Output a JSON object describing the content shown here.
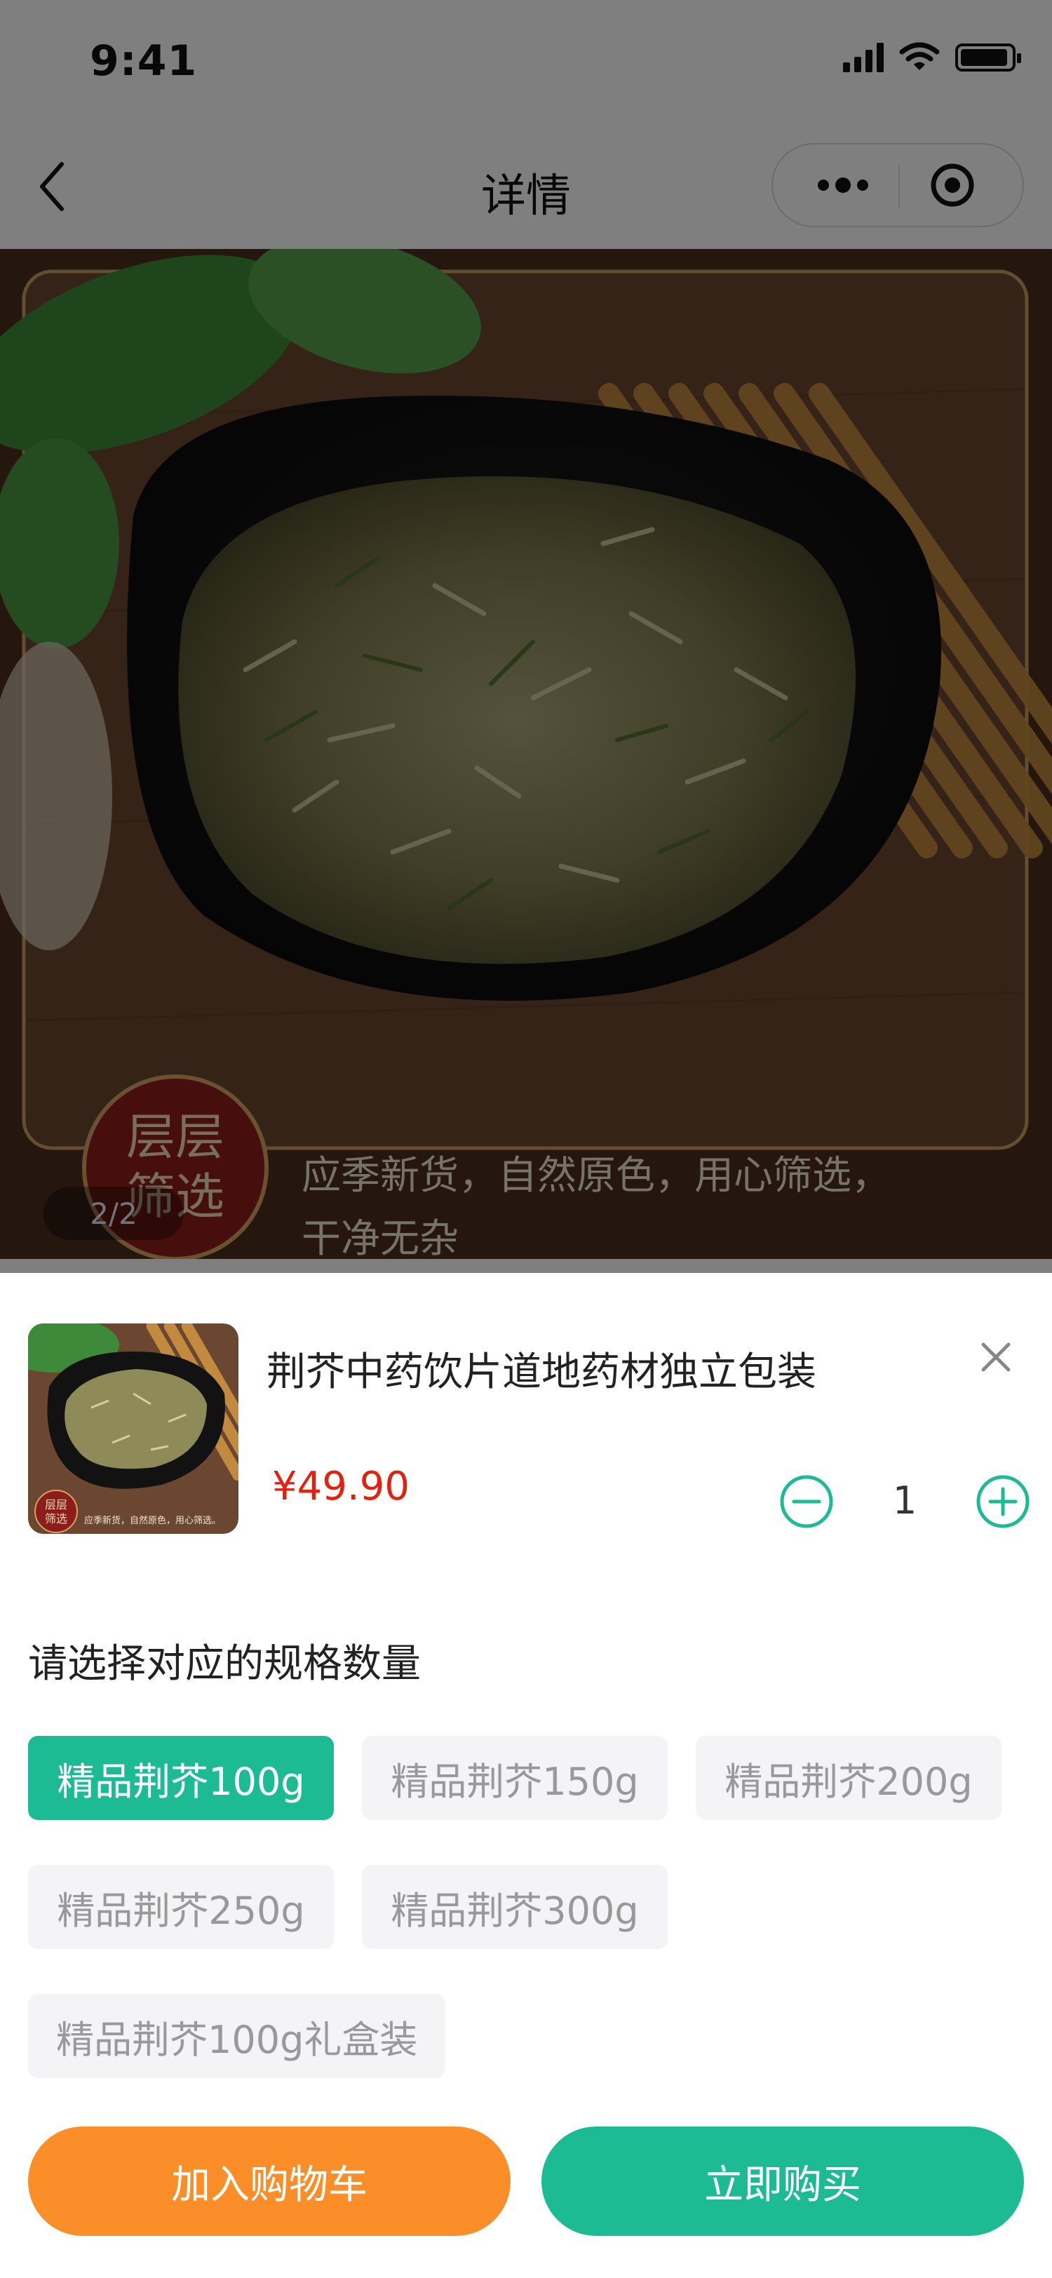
{
  "status_bar": {
    "time": "9:41"
  },
  "nav": {
    "title": "详情"
  },
  "hero": {
    "image_pager": "2/2",
    "badge_text": "层层筛选",
    "caption_line1": "应季新货，自然原色，用心筛选，",
    "caption_line2": "干净无杂"
  },
  "sheet": {
    "product_name": "荆芥中药饮片道地药材独立包装",
    "price": "¥49.90",
    "quantity": "1",
    "spec_title": "请选择对应的规格数量",
    "specs": [
      {
        "label": "精品荆芥100g",
        "selected": true
      },
      {
        "label": "精品荆芥150g",
        "selected": false
      },
      {
        "label": "精品荆芥200g",
        "selected": false
      },
      {
        "label": "精品荆芥250g",
        "selected": false
      },
      {
        "label": "精品荆芥300g",
        "selected": false
      },
      {
        "label": "精品荆芥100g礼盒装",
        "selected": false
      }
    ],
    "add_to_cart": "加入购物车",
    "buy_now": "立即购买"
  },
  "colors": {
    "accent_green": "#1cbb94",
    "cart_orange": "#fb8e28",
    "price_red": "#e4200f",
    "chip_bg": "#f4f4f6"
  },
  "icons": [
    "back-arrow-icon",
    "more-dots-icon",
    "close-capsule-icon",
    "close-icon",
    "minus-circle-icon",
    "plus-circle-icon",
    "signal-icon",
    "wifi-icon",
    "battery-icon"
  ]
}
